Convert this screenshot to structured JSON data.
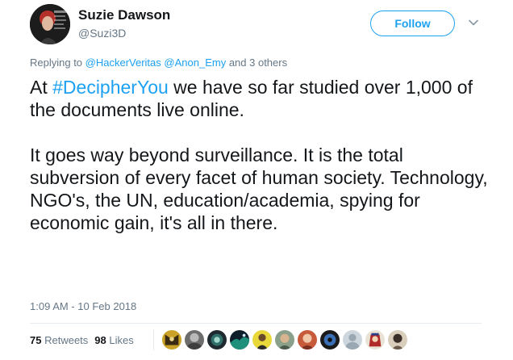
{
  "author": {
    "name": "Suzie Dawson",
    "handle": "@Suzi3D"
  },
  "follow_label": "Follow",
  "reply_context": {
    "prefix": "Replying to ",
    "mention1": "@HackerVeritas",
    "mention2": "@Anon_Emy",
    "suffix": " and 3 others"
  },
  "tweet": {
    "p1_before": "At ",
    "p1_hashtag": "#DecipherYou",
    "p1_after": " we have so far studied over 1,000 of the documents live online.",
    "p2": "It goes way beyond surveillance. It is the total subversion of every facet of human society. Technology, NGO's, the UN, education/academia, spying for economic gain, it's all in there."
  },
  "timestamp": "1:09 AM - 10 Feb 2018",
  "stats": {
    "retweets_count": "75",
    "retweets_label": "Retweets",
    "likes_count": "98",
    "likes_label": "Likes"
  },
  "colors": {
    "accent": "#1da1f2",
    "muted": "#657786",
    "text": "#14171a"
  },
  "icons": [
    "caret-down-icon"
  ]
}
